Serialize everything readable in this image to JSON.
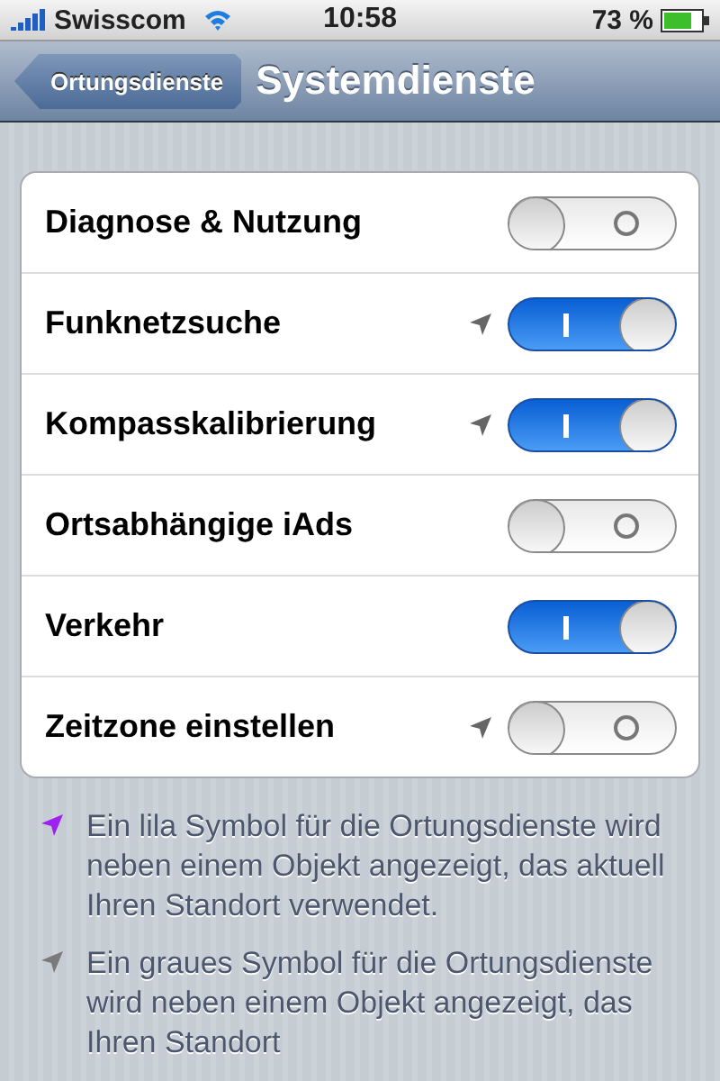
{
  "status_bar": {
    "carrier": "Swisscom",
    "time": "10:58",
    "battery": "73 %"
  },
  "nav_bar": {
    "back": "Ortungsdienste",
    "title": "Systemdienste"
  },
  "rows": [
    {
      "label": "Diagnose & Nutzung",
      "location_icon": false,
      "on": false
    },
    {
      "label": "Funknetzsuche",
      "location_icon": true,
      "on": true
    },
    {
      "label": "Kompasskalibrierung",
      "location_icon": true,
      "on": true
    },
    {
      "label": "Ortsabhängige iAds",
      "location_icon": false,
      "on": false
    },
    {
      "label": "Verkehr",
      "location_icon": false,
      "on": true
    },
    {
      "label": "Zeitzone einstellen",
      "location_icon": true,
      "on": false
    }
  ],
  "notes": [
    {
      "color": "#a020f0",
      "text": "Ein lila Symbol für die Ortungsdienste wird neben einem Objekt angezeigt, das aktuell Ihren Standort verwendet."
    },
    {
      "color": "#7a7a7a",
      "text": "Ein graues Symbol für die Ortungsdienste wird neben einem Objekt angezeigt, das Ihren Standort"
    }
  ]
}
